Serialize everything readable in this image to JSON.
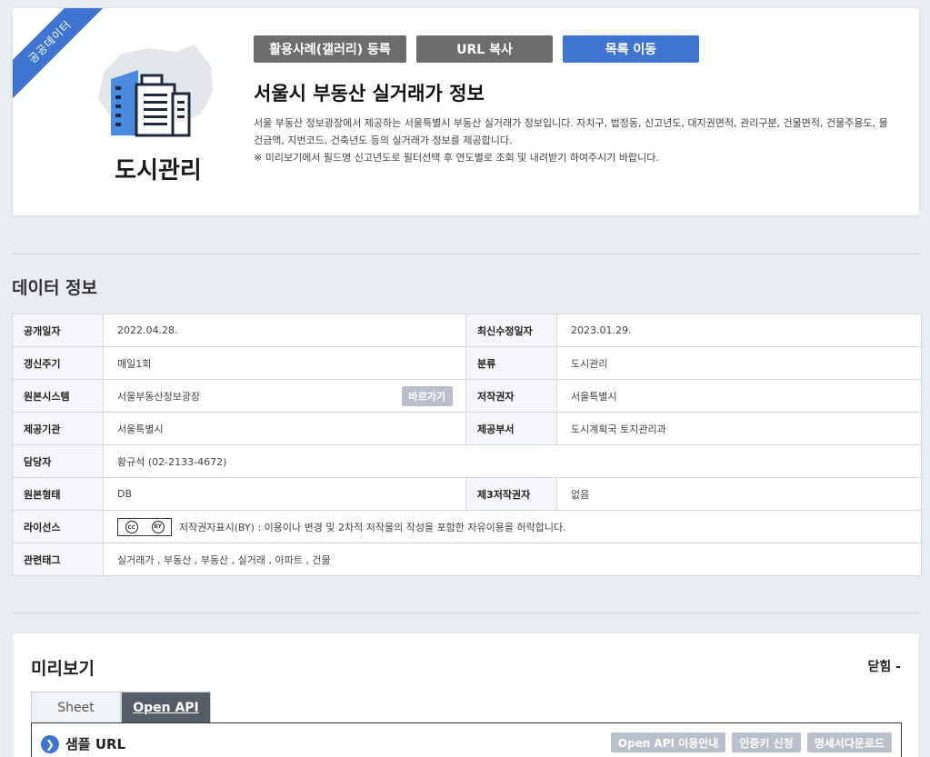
{
  "hero": {
    "ribbon": "공공데이터",
    "category_title": "도시관리",
    "buttons": {
      "gallery": "활용사례(갤러리) 등록",
      "url_copy": "URL 복사",
      "list": "목록 이동"
    },
    "title": "서울시 부동산 실거래가 정보",
    "desc_line1": "서울 부동산 정보광장에서 제공하는 서울특별시 부동산 실거래가 정보입니다. 자치구, 법정동, 신고년도, 대지권면적, 관리구분, 건물면적, 건물주용도, 물",
    "desc_line2": "건금액, 지번코드, 건축년도 등의 실거래가 정보를 제공합니다.",
    "desc_line3": "※ 미리보기에서 필드명 신고년도로 필터선택 후 연도별로 조회 및 내려받기 하여주시기 바랍니다."
  },
  "info": {
    "section_title": "데이터 정보",
    "rows": {
      "published": {
        "label": "공개일자",
        "value": "2022.04.28."
      },
      "updated": {
        "label": "최신수정일자",
        "value": "2023.01.29."
      },
      "cycle": {
        "label": "갱신주기",
        "value": "매일1회"
      },
      "category": {
        "label": "분류",
        "value": "도시관리"
      },
      "source": {
        "label": "원본시스템",
        "value": "서울부동산정보광장",
        "button": "바로가기"
      },
      "copyright": {
        "label": "저작권자",
        "value": "서울특별시"
      },
      "provider": {
        "label": "제공기관",
        "value": "서울특별시"
      },
      "dept": {
        "label": "제공부서",
        "value": "도시계획국 토지관리과"
      },
      "contact": {
        "label": "담당자",
        "value": "황규석 (02-2133-4672)"
      },
      "format": {
        "label": "원본형태",
        "value": "DB"
      },
      "third_party": {
        "label": "제3저작권자",
        "value": "없음"
      },
      "license": {
        "label": "라이선스",
        "badge_text": "BY",
        "value": "저작권자표시(BY) : 이용이나 변경 및 2차적 저작물의 작성을 포함한 자유이용을 허락합니다."
      },
      "tags": {
        "label": "관련태그",
        "value": "실거래가 , 부동산 , 부동산 , 실거래 , 아파트 , 건물"
      }
    }
  },
  "preview": {
    "title": "미리보기",
    "close": "닫힘 -",
    "tabs": [
      "Sheet",
      "Open API"
    ],
    "sample_url": "샘플 URL",
    "buttons": [
      "Open API 이용안내",
      "인증키 신청",
      "명세서다운로드"
    ]
  },
  "colors": {
    "accent_blue": "#3f74d0",
    "button_gray": "#6d6d6d",
    "page_bg": "#e9edf2"
  }
}
